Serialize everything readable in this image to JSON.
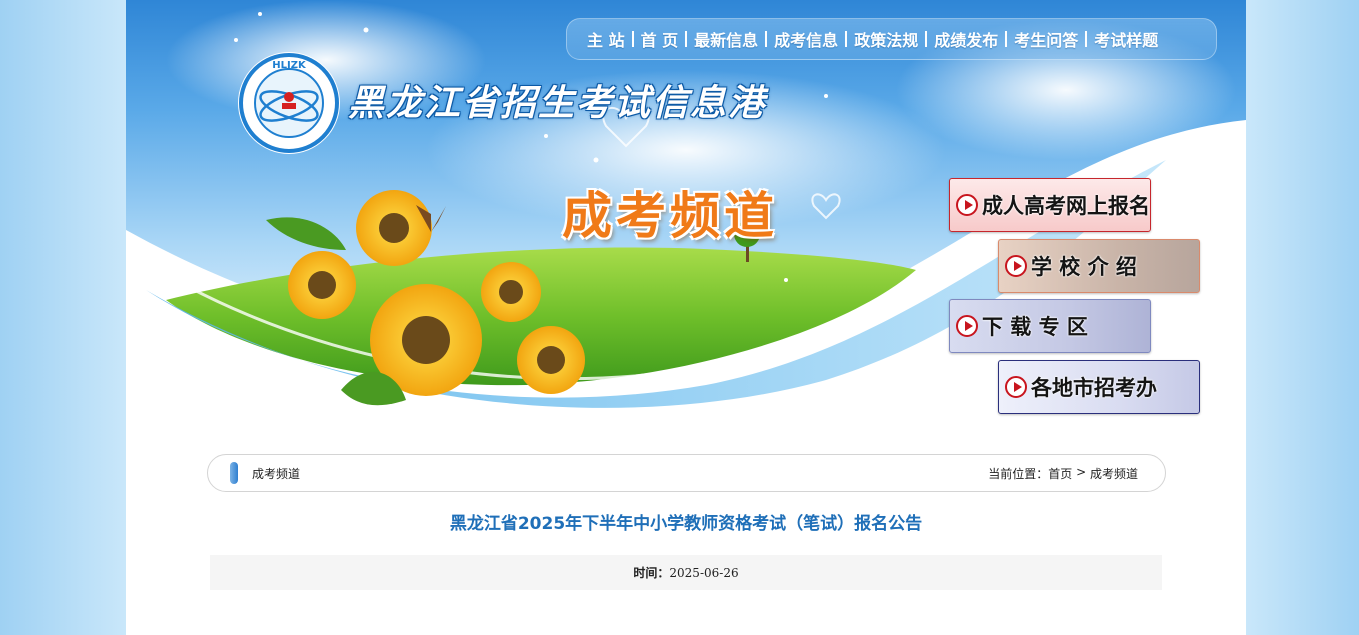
{
  "nav": {
    "items": [
      "主 站",
      "首 页",
      "最新信息",
      "成考信息",
      "政策法规",
      "成绩发布",
      "考生问答",
      "考试样题"
    ]
  },
  "logo": {
    "text": "HLJZK"
  },
  "banner": {
    "site_title": "黑龙江省招生考试信息港",
    "channel_title": "成考频道"
  },
  "side_buttons": [
    {
      "label": "成人高考网上报名"
    },
    {
      "label": "学 校 介 绍"
    },
    {
      "label": "下 载 专 区"
    },
    {
      "label": "各地市招考办"
    }
  ],
  "breadcrumb": {
    "section": "成考频道",
    "location_label": "当前位置：",
    "home": "首页",
    "separator": " > ",
    "current": "成考频道"
  },
  "article": {
    "title": "黑龙江省2025年下半年中小学教师资格考试（笔试）报名公告",
    "time_label": "时间：",
    "time_value": "2025-06-26"
  },
  "colors": {
    "title_blue": "#1f6fb8",
    "channel_orange": "#f07a18",
    "play_red": "#c8151e"
  }
}
